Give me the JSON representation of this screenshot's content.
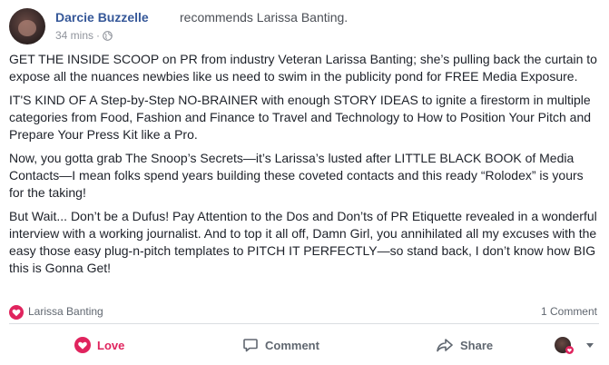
{
  "post": {
    "author": "Darcie Buzzelle",
    "recommends_text": "recommends Larissa Banting.",
    "time": "34 mins",
    "separator": "·",
    "privacy_icon": "globe-icon",
    "paragraphs": [
      "GET THE INSIDE SCOOP on PR from industry Veteran Larissa Banting; she’s pulling back the curtain to expose all the nuances newbies like us need to swim in the publicity pond for FREE Media Exposure.",
      "IT'S KIND OF A Step-by-Step NO-BRAINER with enough STORY IDEAS to ignite a firestorm in multiple categories from Food, Fashion and Finance to Travel and Technology to How to Position Your Pitch and Prepare Your Press Kit like a Pro.",
      "Now, you gotta grab The Snoop’s Secrets—it’s Larissa’s lusted after LITTLE BLACK BOOK of Media Contacts—I mean folks spend years building these coveted contacts and this ready “Rolodex” is yours for the taking!",
      "But Wait... Don’t be a Dufus! Pay Attention to the Dos and Don’ts of PR Etiquette revealed in a wonderful interview with a working journalist. And to top it all off, Damn Girl, you annihilated all my excuses with the easy those easy plug-n-pitch templates to PITCH IT PERFECTLY—so stand back, I don’t know how BIG this is Gonna Get!"
    ]
  },
  "summary": {
    "reaction_icon": "love-reaction-icon",
    "reaction_name": "Larissa Banting",
    "comment_count": "1 Comment"
  },
  "actions": {
    "love": "Love",
    "comment": "Comment",
    "share": "Share"
  },
  "colors": {
    "link": "#365899",
    "love": "#e0245e",
    "muted": "#606770"
  }
}
